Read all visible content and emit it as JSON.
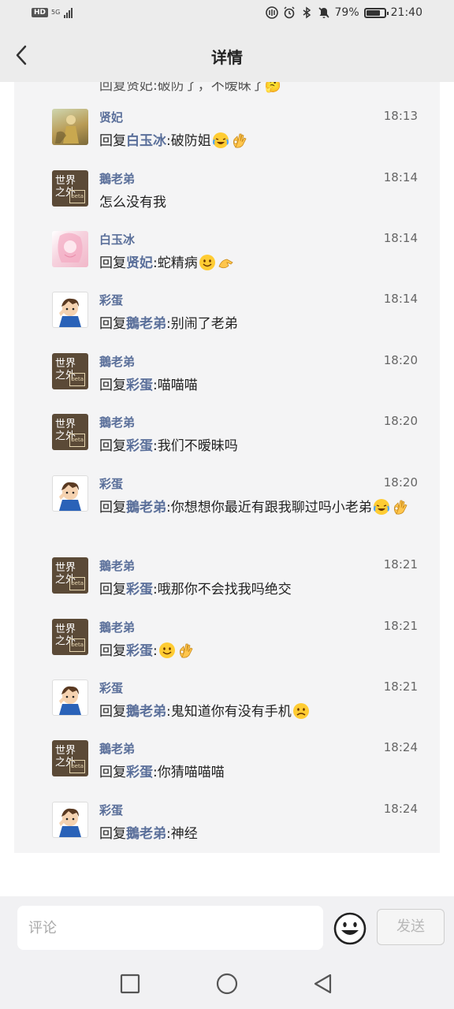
{
  "status_bar": {
    "hd": "HD",
    "network": "5G",
    "battery": "79%",
    "battery_level": 0.79,
    "time": "21:40"
  },
  "header": {
    "title": "详情"
  },
  "partial_comment": {
    "text": "回复贤妃:破防了，不暧昧了🤔"
  },
  "comments": [
    {
      "avatar": "xianfei",
      "name": "贤妃",
      "time": "18:13",
      "reply_prefix": "回复",
      "reply_to": "白玉冰",
      "colon": ":",
      "text": "破防姐",
      "emojis": [
        "laugh-cry",
        "ok-hand"
      ]
    },
    {
      "avatar": "world",
      "name": "鵝老弟",
      "time": "18:14",
      "reply_prefix": "",
      "reply_to": "",
      "colon": "",
      "text": "怎么没有我",
      "emojis": []
    },
    {
      "avatar": "bai",
      "name": "白玉冰",
      "time": "18:14",
      "reply_prefix": "回复",
      "reply_to": "贤妃",
      "colon": ":",
      "text": "蛇精病",
      "emojis": [
        "smile",
        "ok-hand-side"
      ]
    },
    {
      "avatar": "caidan",
      "name": "彩蛋",
      "time": "18:14",
      "reply_prefix": "回复",
      "reply_to": "鵝老弟",
      "colon": ":",
      "text": "别闹了老弟",
      "emojis": []
    },
    {
      "avatar": "world",
      "name": "鵝老弟",
      "time": "18:20",
      "reply_prefix": "回复",
      "reply_to": "彩蛋",
      "colon": ":",
      "text": "喵喵喵",
      "emojis": []
    },
    {
      "avatar": "world",
      "name": "鵝老弟",
      "time": "18:20",
      "reply_prefix": "回复",
      "reply_to": "彩蛋",
      "colon": ":",
      "text": "我们不暧昧吗",
      "emojis": []
    },
    {
      "avatar": "caidan",
      "name": "彩蛋",
      "time": "18:20",
      "reply_prefix": "回复",
      "reply_to": "鵝老弟",
      "colon": ":",
      "text": "你想想你最近有跟我聊过吗小老弟",
      "emojis": [
        "laugh-cry",
        "ok-hand"
      ]
    },
    {
      "avatar": "world",
      "name": "鵝老弟",
      "time": "18:21",
      "reply_prefix": "回复",
      "reply_to": "彩蛋",
      "colon": ":",
      "text": "哦那你不会找我吗绝交",
      "emojis": []
    },
    {
      "avatar": "world",
      "name": "鵝老弟",
      "time": "18:21",
      "reply_prefix": "回复",
      "reply_to": "彩蛋",
      "colon": ":",
      "text": "",
      "emojis": [
        "smile",
        "ok-hand"
      ]
    },
    {
      "avatar": "caidan",
      "name": "彩蛋",
      "time": "18:21",
      "reply_prefix": "回复",
      "reply_to": "鵝老弟",
      "colon": ":",
      "text": "鬼知道你有没有手机",
      "emojis": [
        "frown"
      ]
    },
    {
      "avatar": "world",
      "name": "鵝老弟",
      "time": "18:24",
      "reply_prefix": "回复",
      "reply_to": "彩蛋",
      "colon": ":",
      "text": "你猜喵喵喵",
      "emojis": []
    },
    {
      "avatar": "caidan",
      "name": "彩蛋",
      "time": "18:24",
      "reply_prefix": "回复",
      "reply_to": "鵝老弟",
      "colon": ":",
      "text": "神经",
      "emojis": []
    }
  ],
  "world_avatar": {
    "line1": "世界",
    "line2": "之外",
    "tag": "beta"
  },
  "input": {
    "placeholder": "评论",
    "send_label": "发送"
  },
  "colors": {
    "accent_name": "#5a6f9a",
    "background": "#f4f4f5",
    "bar": "#ececec"
  }
}
